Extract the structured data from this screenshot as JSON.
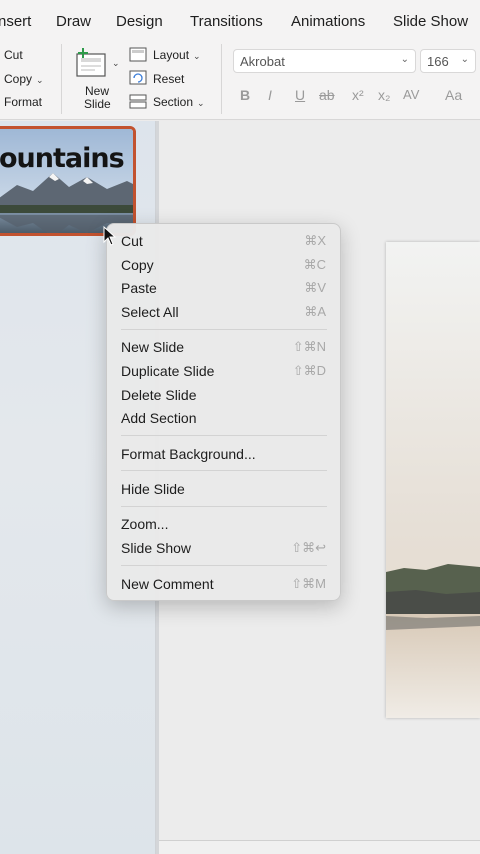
{
  "tabs": [
    "nsert",
    "Draw",
    "Design",
    "Transitions",
    "Animations",
    "Slide Show"
  ],
  "ribbon": {
    "clipboard": {
      "cut": "Cut",
      "copy": "Copy",
      "format": "Format"
    },
    "slides": {
      "new_slide_line1": "New",
      "new_slide_line2": "Slide",
      "layout": "Layout",
      "reset": "Reset",
      "section": "Section"
    },
    "font": {
      "name": "Akrobat",
      "size": "166"
    },
    "format_buttons": [
      "B",
      "I",
      "U",
      "ab",
      "x²",
      "x₂",
      "AV",
      "Aa"
    ]
  },
  "thumbnail": {
    "title": "ountains"
  },
  "context_menu": {
    "items": [
      {
        "label": "Cut",
        "shortcut": "⌘X"
      },
      {
        "label": "Copy",
        "shortcut": "⌘C"
      },
      {
        "label": "Paste",
        "shortcut": "⌘V"
      },
      {
        "label": "Select All",
        "shortcut": "⌘A"
      },
      {
        "label": "New Slide",
        "shortcut": "⇧⌘N"
      },
      {
        "label": "Duplicate Slide",
        "shortcut": "⇧⌘D"
      },
      {
        "label": "Delete Slide",
        "shortcut": ""
      },
      {
        "label": "Add Section",
        "shortcut": ""
      },
      {
        "label": "Format Background...",
        "shortcut": ""
      },
      {
        "label": "Hide Slide",
        "shortcut": ""
      },
      {
        "label": "Zoom...",
        "shortcut": ""
      },
      {
        "label": "Slide Show",
        "shortcut": "⇧⌘↩"
      },
      {
        "label": "New Comment",
        "shortcut": "⇧⌘M"
      }
    ]
  },
  "colors": {
    "thumbnail_border": "#c2522f",
    "menu_bg": "#e9e9e9",
    "shortcut": "#a8a8a8"
  }
}
